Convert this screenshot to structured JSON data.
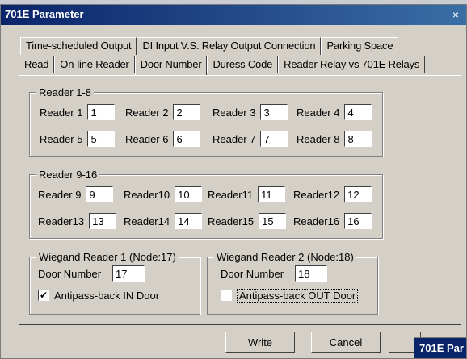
{
  "window": {
    "title": "701E Parameter",
    "close_glyph": "×"
  },
  "tabs_row1": [
    "Time-scheduled Output",
    "DI Input  V.S. Relay Output Connection",
    "Parking Space"
  ],
  "tabs_row2": [
    "Read",
    "On-line Reader",
    "Door Number",
    "Duress Code",
    "Reader Relay vs 701E Relays"
  ],
  "active_tab": "Door Number",
  "group1": {
    "title": "Reader 1-8",
    "readers": [
      {
        "label": "Reader 1",
        "value": "1"
      },
      {
        "label": "Reader 2",
        "value": "2"
      },
      {
        "label": "Reader 3",
        "value": "3"
      },
      {
        "label": "Reader 4",
        "value": "4"
      },
      {
        "label": "Reader 5",
        "value": "5"
      },
      {
        "label": "Reader 6",
        "value": "6"
      },
      {
        "label": "Reader 7",
        "value": "7"
      },
      {
        "label": "Reader 8",
        "value": "8"
      }
    ]
  },
  "group2": {
    "title": "Reader 9-16",
    "readers": [
      {
        "label": "Reader 9",
        "value": "9"
      },
      {
        "label": "Reader10",
        "value": "10"
      },
      {
        "label": "Reader11",
        "value": "11"
      },
      {
        "label": "Reader12",
        "value": "12"
      },
      {
        "label": "Reader13",
        "value": "13"
      },
      {
        "label": "Reader14",
        "value": "14"
      },
      {
        "label": "Reader15",
        "value": "15"
      },
      {
        "label": "Reader16",
        "value": "16"
      }
    ]
  },
  "wiegand1": {
    "title": "Wiegand Reader 1 (Node:17)",
    "door_label": "Door Number",
    "door_value": "17",
    "check_label": "Antipass-back  IN  Door",
    "checked": true,
    "check_glyph": "✔"
  },
  "wiegand2": {
    "title": "Wiegand Reader 2 (Node:18)",
    "door_label": "Door Number",
    "door_value": "18",
    "check_label": "Antipass-back  OUT  Door",
    "checked": false,
    "check_glyph": ""
  },
  "buttons": {
    "write": "Write",
    "cancel": "Cancel"
  },
  "taskbar_chip": "701E Par"
}
